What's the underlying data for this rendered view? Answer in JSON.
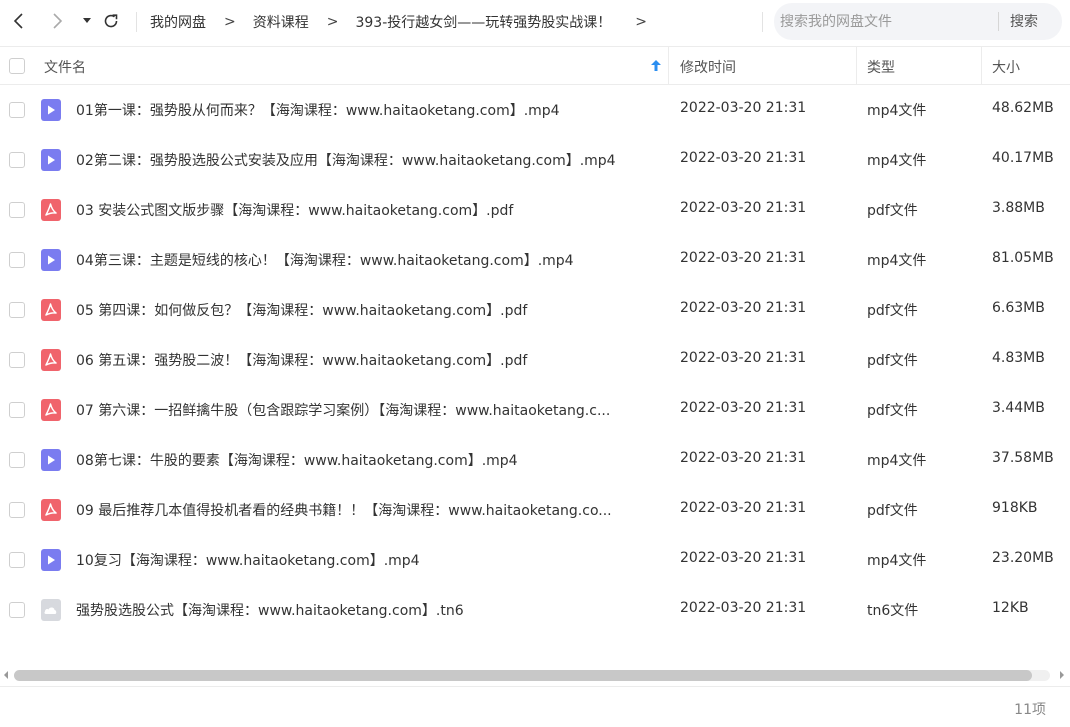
{
  "toolbar": {
    "breadcrumb": [
      "我的网盘",
      "资料课程",
      "393-投行越女剑——玩转强势股实战课！"
    ],
    "breadcrumb_arrow": ">",
    "search_placeholder": "搜索我的网盘文件",
    "search_button": "搜索"
  },
  "columns": {
    "name": "文件名",
    "modified": "修改时间",
    "type": "类型",
    "size": "大小"
  },
  "files": [
    {
      "icon": "video",
      "name": "01第一课：强势股从何而来？【海淘课程：www.haitaoketang.com】.mp4",
      "modified": "2022-03-20 21:31",
      "type": "mp4文件",
      "size": "48.62MB"
    },
    {
      "icon": "video",
      "name": "02第二课：强势股选股公式安装及应用【海淘课程：www.haitaoketang.com】.mp4",
      "modified": "2022-03-20 21:31",
      "type": "mp4文件",
      "size": "40.17MB"
    },
    {
      "icon": "pdf",
      "name": "03 安装公式图文版步骤【海淘课程：www.haitaoketang.com】.pdf",
      "modified": "2022-03-20 21:31",
      "type": "pdf文件",
      "size": "3.88MB"
    },
    {
      "icon": "video",
      "name": "04第三课：主题是短线的核心！【海淘课程：www.haitaoketang.com】.mp4",
      "modified": "2022-03-20 21:31",
      "type": "mp4文件",
      "size": "81.05MB"
    },
    {
      "icon": "pdf",
      "name": "05 第四课：如何做反包？【海淘课程：www.haitaoketang.com】.pdf",
      "modified": "2022-03-20 21:31",
      "type": "pdf文件",
      "size": "6.63MB"
    },
    {
      "icon": "pdf",
      "name": "06 第五课：强势股二波！【海淘课程：www.haitaoketang.com】.pdf",
      "modified": "2022-03-20 21:31",
      "type": "pdf文件",
      "size": "4.83MB"
    },
    {
      "icon": "pdf",
      "name": "07 第六课：一招鲜擒牛股（包含跟踪学习案例）【海淘课程：www.haitaoketang.c...",
      "modified": "2022-03-20 21:31",
      "type": "pdf文件",
      "size": "3.44MB"
    },
    {
      "icon": "video",
      "name": "08第七课：牛股的要素【海淘课程：www.haitaoketang.com】.mp4",
      "modified": "2022-03-20 21:31",
      "type": "mp4文件",
      "size": "37.58MB"
    },
    {
      "icon": "pdf",
      "name": "09 最后推荐几本值得投机者看的经典书籍！！【海淘课程：www.haitaoketang.co...",
      "modified": "2022-03-20 21:31",
      "type": "pdf文件",
      "size": "918KB"
    },
    {
      "icon": "video",
      "name": "10复习【海淘课程：www.haitaoketang.com】.mp4",
      "modified": "2022-03-20 21:31",
      "type": "mp4文件",
      "size": "23.20MB"
    },
    {
      "icon": "other",
      "name": "强势股选股公式【海淘课程：www.haitaoketang.com】.tn6",
      "modified": "2022-03-20 21:31",
      "type": "tn6文件",
      "size": "12KB"
    }
  ],
  "footer": {
    "count": "11项"
  },
  "colors": {
    "video_icon": "#7a7cf0",
    "pdf_icon": "#f0646c",
    "other_icon": "#d7d9de",
    "sort_arrow": "#2b8ef0"
  }
}
